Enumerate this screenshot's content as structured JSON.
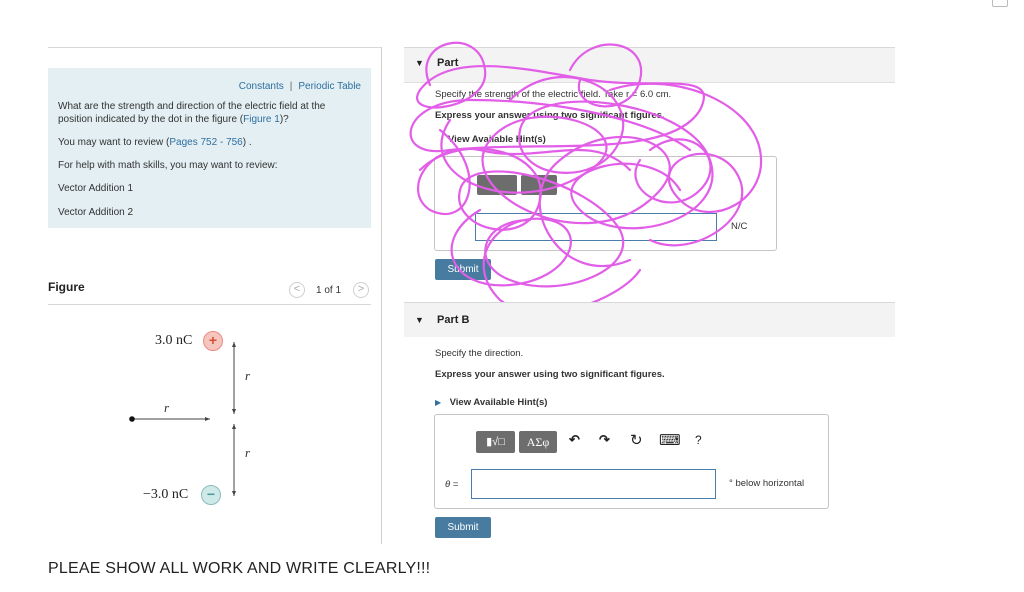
{
  "info": {
    "constants_link": "Constants",
    "separator": "|",
    "periodic_table_link": "Periodic Table",
    "question": "What are the strength and direction of the electric field at the position indicated by the dot in the figure (Figure 1)?",
    "question_prefix": "What are the strength and direction of the electric field at the position indicated by the dot in the figure (",
    "figure_link": "Figure 1",
    "question_suffix": ")?",
    "review_prefix": "You may want to review (",
    "review_link": "Pages 752 - 756",
    "review_suffix": ") .",
    "help_text": "For help with math skills, you may want to review:",
    "vector_addition_1": "Vector Addition 1",
    "vector_addition_2": "Vector Addition 2"
  },
  "figure": {
    "title": "Figure",
    "pager": "1 of 1",
    "prev_symbol": "<",
    "next_symbol": ">",
    "charge_top_label": "3.0 nC",
    "charge_top_sign": "+",
    "charge_bottom_label": "−3.0 nC",
    "charge_bottom_sign": "−",
    "r_label": "r"
  },
  "partA": {
    "title_fragment": "Part",
    "prompt_fragment": "Specify the strength of the electric field. Take r = 6.0 cm.",
    "express_fragment": "Express your answer using two significant figures.",
    "hints_fragment": "View Available Hint(s)",
    "unit": "N/C",
    "submit": "Submit"
  },
  "partB": {
    "title": "Part B",
    "prompt": "Specify the direction.",
    "express": "Express your answer using two significant figures.",
    "hints": "View Available Hint(s)",
    "toolbar": {
      "template_button": "▮√□",
      "greek_button": "ΑΣφ",
      "undo_icon": "↶",
      "redo_icon": "↷",
      "reset_icon": "↻",
      "keyboard_icon": "⌨",
      "help_icon": "?"
    },
    "variable": "θ =",
    "input_value": "",
    "unit": "° below horizontal",
    "submit": "Submit"
  },
  "footer": "PLEAE SHOW ALL WORK AND WRITE CLEARLY!!!",
  "scribble_color": "#e25ee8"
}
